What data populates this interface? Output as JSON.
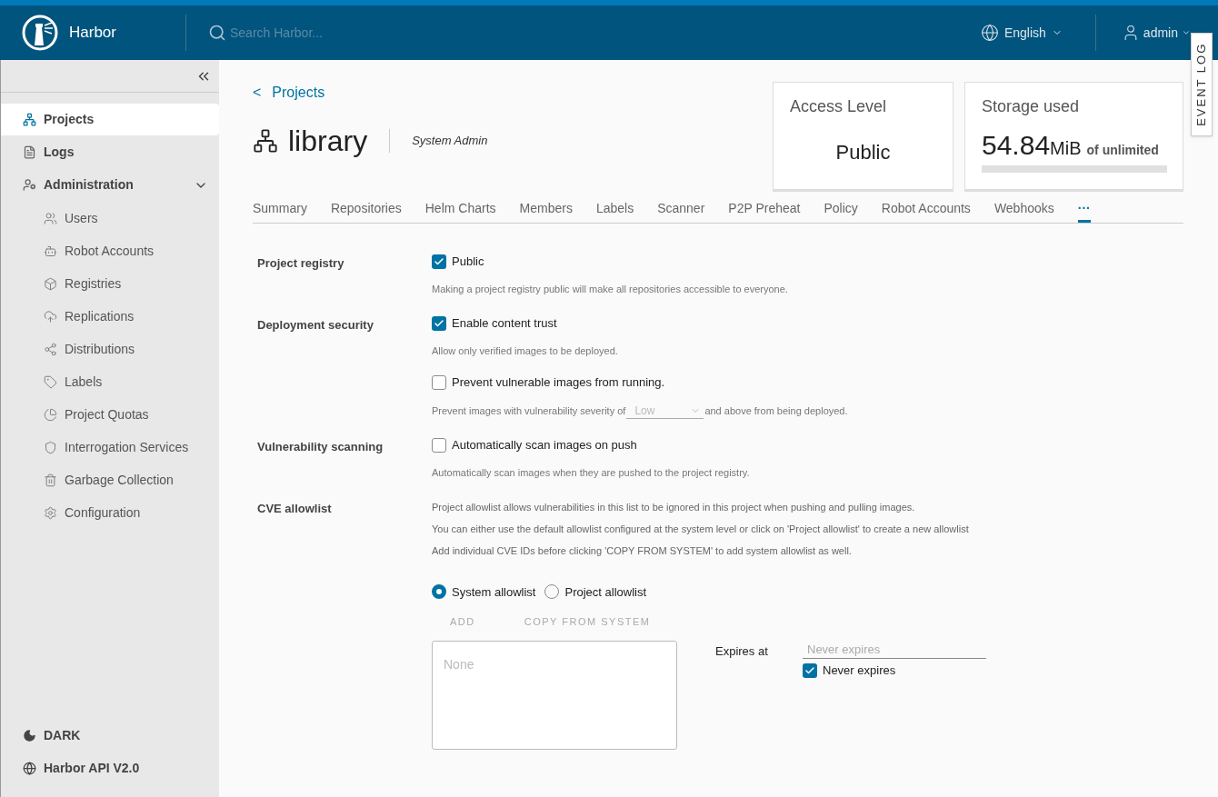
{
  "header": {
    "brand": "Harbor",
    "search_placeholder": "Search Harbor...",
    "language": "English",
    "user": "admin"
  },
  "event_log": "EVENT LOG",
  "sidebar": {
    "items": [
      {
        "label": "Projects",
        "selected": true
      },
      {
        "label": "Logs",
        "selected": false
      },
      {
        "label": "Administration",
        "selected": false,
        "expanded": true,
        "children": [
          {
            "label": "Users",
            "selected": false
          },
          {
            "label": "Robot Accounts",
            "selected": false
          },
          {
            "label": "Registries",
            "selected": false
          },
          {
            "label": "Replications",
            "selected": false
          },
          {
            "label": "Distributions",
            "selected": false
          },
          {
            "label": "Labels",
            "selected": false
          },
          {
            "label": "Project Quotas",
            "selected": false
          },
          {
            "label": "Interrogation Services",
            "selected": false
          },
          {
            "label": "Garbage Collection",
            "selected": false
          },
          {
            "label": "Configuration",
            "selected": false
          }
        ]
      }
    ],
    "footer": [
      {
        "label": "DARK"
      },
      {
        "label": "Harbor API V2.0"
      }
    ]
  },
  "breadcrumb": {
    "arrow": "<",
    "label": "Projects"
  },
  "project": {
    "name": "library",
    "role": "System Admin"
  },
  "cards": {
    "access": {
      "title": "Access Level",
      "value": "Public"
    },
    "storage": {
      "title": "Storage used",
      "value": "54.84",
      "unit": "MiB",
      "suffix": "of unlimited"
    }
  },
  "tabs": [
    {
      "label": "Summary",
      "selected": false
    },
    {
      "label": "Repositories",
      "selected": false
    },
    {
      "label": "Helm Charts",
      "selected": false
    },
    {
      "label": "Members",
      "selected": false
    },
    {
      "label": "Labels",
      "selected": false
    },
    {
      "label": "Scanner",
      "selected": false
    },
    {
      "label": "P2P Preheat",
      "selected": false
    },
    {
      "label": "Policy",
      "selected": false
    },
    {
      "label": "Robot Accounts",
      "selected": false
    },
    {
      "label": "Webhooks",
      "selected": false
    },
    {
      "label": "···",
      "selected": true
    }
  ],
  "settings": [
    {
      "label": "Project registry",
      "options": [
        {
          "label": "Public",
          "checked": true,
          "hint": "Making a project registry public will make all repositories accessible to everyone."
        }
      ]
    },
    {
      "label": "Deployment security",
      "options": [
        {
          "label": "Enable content trust",
          "checked": true,
          "hint": "Allow only verified images to be deployed."
        },
        {
          "label": "Prevent vulnerable images from running.",
          "checked": false,
          "hint_before": "Prevent images with vulnerability severity of",
          "select": "Low",
          "hint_after": "and above from being deployed."
        }
      ]
    },
    {
      "label": "Vulnerability scanning",
      "options": [
        {
          "label": "Automatically scan images on push",
          "checked": false,
          "hint": "Automatically scan images when they are pushed to the project registry."
        }
      ]
    }
  ],
  "cve": {
    "label": "CVE allowlist",
    "lines": [
      "Project allowlist allows vulnerabilities in this list to be ignored in this project when pushing and pulling images.",
      "You can either use the default allowlist configured at the system level or click on 'Project allowlist' to create a new allowlist",
      "Add individual CVE IDs before clicking 'COPY FROM SYSTEM' to add system allowlist as well."
    ],
    "radios": [
      {
        "label": "System allowlist",
        "selected": true
      },
      {
        "label": "Project allowlist",
        "selected": false
      }
    ],
    "buttons": [
      {
        "label": "ADD",
        "disabled": true
      },
      {
        "label": "COPY FROM SYSTEM",
        "disabled": true
      }
    ],
    "list_placeholder": "None",
    "expires_label": "Expires at",
    "expires_placeholder": "Never expires",
    "never": {
      "label": "Never expires",
      "checked": true
    }
  }
}
